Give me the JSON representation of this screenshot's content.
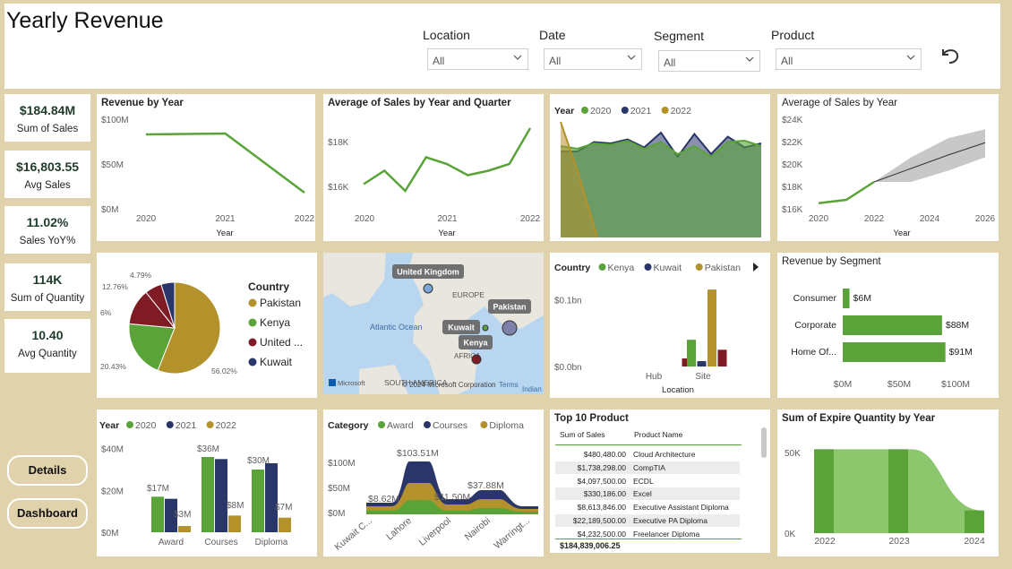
{
  "header": {
    "title": "Yearly Revenue",
    "filters": [
      {
        "label": "Location",
        "value": "All"
      },
      {
        "label": "Date",
        "value": "All"
      },
      {
        "label": "Segment",
        "value": "All"
      },
      {
        "label": "Product",
        "value": "All"
      }
    ]
  },
  "kpis": [
    {
      "value": "$184.84M",
      "label": "Sum of Sales"
    },
    {
      "value": "$16,803.55",
      "label": "Avg Sales"
    },
    {
      "value": "11.02%",
      "label": "Sales YoY%"
    },
    {
      "value": "114K",
      "label": "Sum of Quantity"
    },
    {
      "value": "10.40",
      "label": "Avg Quantity"
    }
  ],
  "nav": {
    "details": "Details",
    "dashboard": "Dashboard"
  },
  "colors": {
    "green": "#5aa339",
    "navy": "#2a3569",
    "gold": "#b3912b",
    "maroon": "#7e1b25",
    "bg": "#e0d3ab"
  },
  "map": {
    "labels": [
      "United Kingdom",
      "Pakistan",
      "Kuwait",
      "Kenya"
    ],
    "regions": [
      "EUROPE",
      "Atlantic Ocean",
      "AFRICA",
      "SOUTH AMERICA",
      "Indian Oc"
    ],
    "credits": "© 2024 Microsoft Corporation",
    "terms": "Terms",
    "ms": "Microsoft"
  },
  "chart_data": [
    {
      "id": "rev_year",
      "type": "line",
      "title": "Revenue by Year",
      "xlabel": "Year",
      "x": [
        "2020",
        "2021",
        "2022"
      ],
      "values": [
        83,
        84,
        18
      ],
      "yticks": [
        "$0M",
        "$50M",
        "$100M"
      ],
      "ylim": [
        0,
        100
      ]
    },
    {
      "id": "avg_quarter",
      "type": "line",
      "title": "Average of Sales by Year and Quarter",
      "xlabel": "Year",
      "xticks": [
        "2020",
        "2021",
        "2022"
      ],
      "values": [
        16100,
        16700,
        15800,
        17300,
        17000,
        16500,
        16700,
        17000,
        18600
      ],
      "yticks": [
        "$16K",
        "$18K"
      ],
      "ylim": [
        15000,
        19000
      ]
    },
    {
      "id": "year_area",
      "type": "area",
      "legend_title": "Year",
      "series": [
        {
          "name": "2020",
          "values": [
            0.68,
            0.66,
            0.7,
            0.69,
            0.72,
            0.66,
            0.71,
            0.62,
            0.68,
            0.6,
            0.71,
            0.72,
            0.68
          ]
        },
        {
          "name": "2021",
          "values": [
            0.64,
            0.64,
            0.71,
            0.7,
            0.73,
            0.67,
            0.78,
            0.6,
            0.77,
            0.62,
            0.75,
            0.67,
            0.7
          ]
        },
        {
          "name": "2022",
          "values": [
            0.86,
            0.46,
            0.0
          ]
        }
      ]
    },
    {
      "id": "avg_year",
      "type": "line",
      "title": "Average of Sales by Year",
      "xlabel": "Year",
      "x": [
        "2020",
        "2021",
        "2022",
        "2023",
        "2024",
        "2025",
        "2026"
      ],
      "values": [
        16500,
        16800,
        18400
      ],
      "forecast": [
        18400,
        19600,
        20800,
        21900
      ],
      "forecast_low": [
        18400,
        18400,
        19400,
        20600
      ],
      "forecast_high": [
        18400,
        20600,
        22300,
        23100
      ],
      "yticks": [
        "$16K",
        "$18K",
        "$20K",
        "$22K",
        "$24K"
      ],
      "xticks": [
        "2020",
        "2022",
        "2024",
        "2026"
      ],
      "ylim": [
        16000,
        24000
      ]
    },
    {
      "id": "country_pie",
      "type": "pie",
      "legend_title": "Country",
      "labels": [
        "Pakistan",
        "Kenya",
        "United ...",
        "Kuwait"
      ],
      "values": [
        56.02,
        20.43,
        12.76,
        4.79
      ],
      "extra_labels": [
        "56.02%",
        "20.43%",
        "12.76%",
        "4.79%",
        "6%"
      ]
    },
    {
      "id": "country_loc",
      "type": "bar",
      "legend_title": "Country",
      "series_names": [
        "Kenya",
        "Kuwait",
        "Pakistan"
      ],
      "categories": [
        "Hub",
        "Site"
      ],
      "xlabel": "Location",
      "yticks": [
        "$0.0bn",
        "$0.1bn"
      ],
      "series": [
        {
          "name": "Hub",
          "values": [
            0,
            0,
            0,
            0.012
          ]
        },
        {
          "name": "Site",
          "values": [
            0.04,
            0.008,
            0.115,
            0.025
          ]
        }
      ],
      "ylim": [
        0,
        0.15
      ]
    },
    {
      "id": "rev_segment",
      "type": "bar",
      "title": "Revenue by Segment",
      "categories": [
        "Consumer",
        "Corporate",
        "Home Of..."
      ],
      "values": [
        6,
        88,
        91
      ],
      "labels": [
        "$6M",
        "$88M",
        "$91M"
      ],
      "xticks": [
        "$0M",
        "$50M",
        "$100M"
      ],
      "xlim": [
        0,
        110
      ]
    },
    {
      "id": "year_category",
      "type": "bar",
      "legend_title": "Year",
      "series_names": [
        "2020",
        "2021",
        "2022"
      ],
      "categories": [
        "Award",
        "Courses",
        "Diploma"
      ],
      "series": [
        {
          "name": "2020",
          "values": [
            17,
            36,
            30
          ]
        },
        {
          "name": "2021",
          "values": [
            16,
            35,
            33
          ]
        },
        {
          "name": "2022",
          "values": [
            3,
            8,
            7
          ]
        }
      ],
      "labels": [
        "$17M",
        "$3M",
        "$36M",
        "$8M",
        "$30M",
        "$7M"
      ],
      "yticks": [
        "$0M",
        "$20M",
        "$40M"
      ],
      "ylim": [
        0,
        45
      ]
    },
    {
      "id": "category_ribbon",
      "type": "area",
      "legend_title": "Category",
      "series_names": [
        "Award",
        "Courses",
        "Diploma"
      ],
      "categories": [
        "Kuwait C...",
        "Lahore",
        "Liverpool",
        "Nairobi",
        "Warringt..."
      ],
      "labels": [
        "$8.62M",
        "$103.51M",
        "$11.50M",
        "$37.88M"
      ],
      "yticks": [
        "$0M",
        "$50M",
        "$100M"
      ],
      "ylim": [
        0,
        120
      ]
    },
    {
      "id": "top_products",
      "type": "table",
      "title": "Top 10 Product",
      "columns": [
        "Sum of Sales",
        "Product Name"
      ],
      "rows": [
        [
          "$480,480.00",
          "Cloud Architecture"
        ],
        [
          "$1,738,298.00",
          "CompTIA"
        ],
        [
          "$4,097,500.00",
          "ECDL"
        ],
        [
          "$330,186.00",
          "Excel"
        ],
        [
          "$8,613,846.00",
          "Executive Assistant Diploma"
        ],
        [
          "$22,189,500.00",
          "Executive PA Diploma"
        ],
        [
          "$4,232,500.00",
          "Freelancer Diploma"
        ]
      ],
      "total": "$184,839,006.25"
    },
    {
      "id": "expire_qty",
      "type": "area",
      "title": "Sum of Expire Quantity by Year",
      "x": [
        "2022",
        "2023",
        "2024"
      ],
      "values": [
        52000,
        52000,
        14000
      ],
      "yticks": [
        "0K",
        "50K"
      ],
      "ylim": [
        0,
        60000
      ]
    }
  ]
}
